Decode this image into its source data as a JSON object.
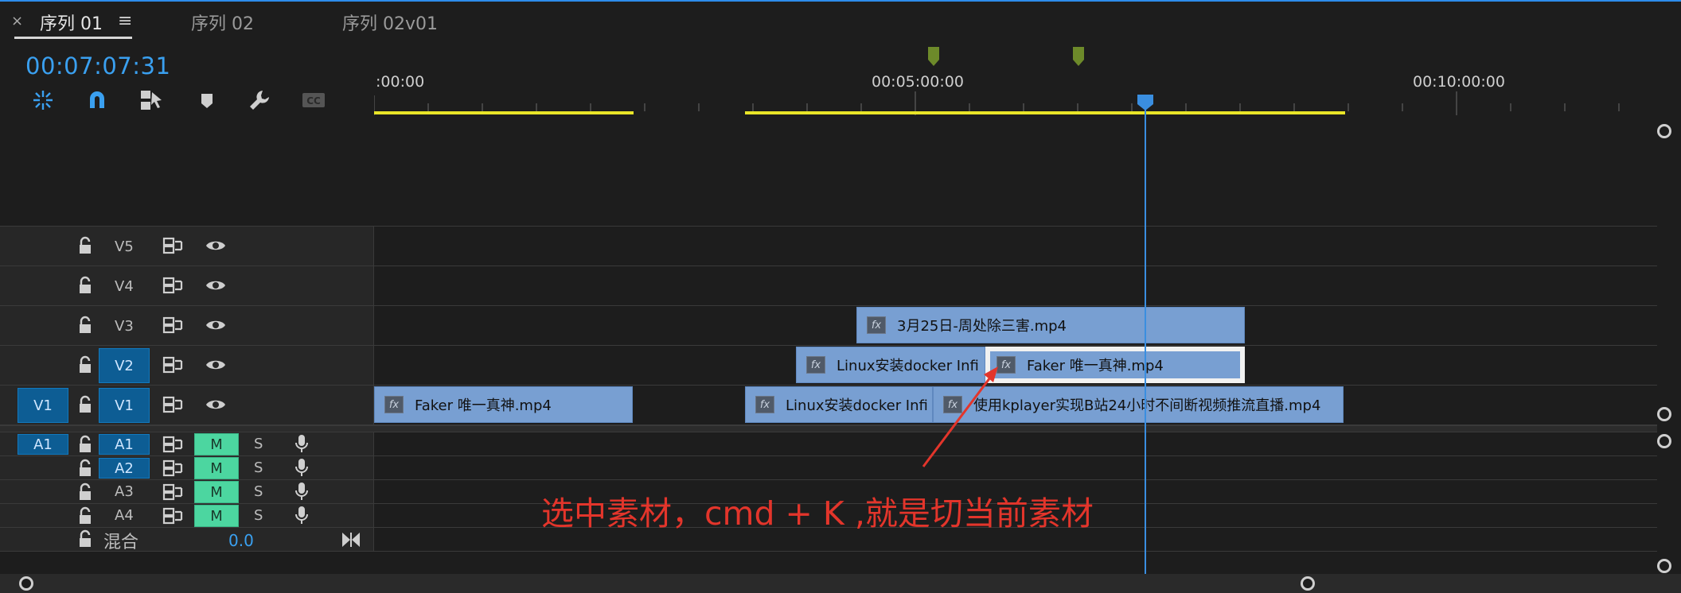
{
  "tabs": {
    "close": "×",
    "menu": "≡",
    "items": [
      "序列 01",
      "序列 02",
      "序列 02v01"
    ]
  },
  "timecode": "00:07:07:31",
  "toolbar": {
    "tools": [
      "snap-icon",
      "magnet-link-icon",
      "linked-selection-icon",
      "add-marker-icon",
      "wrench-icon",
      "cc-icon"
    ]
  },
  "ruler": {
    "labels": [
      ":00:00",
      "00:05:00:00",
      "00:10:00:00"
    ]
  },
  "tracks": {
    "video": [
      {
        "name": "V5",
        "source": "",
        "targeted": false
      },
      {
        "name": "V4",
        "source": "",
        "targeted": false
      },
      {
        "name": "V3",
        "source": "",
        "targeted": false
      },
      {
        "name": "V2",
        "source": "",
        "targeted": true
      },
      {
        "name": "V1",
        "source": "V1",
        "targeted": true
      }
    ],
    "audio": [
      {
        "name": "A1",
        "source": "A1",
        "mute": "M",
        "solo": "S"
      },
      {
        "name": "A2",
        "source": "",
        "mute": "M",
        "solo": "S"
      },
      {
        "name": "A3",
        "source": "",
        "mute": "M",
        "solo": "S"
      },
      {
        "name": "A4",
        "source": "",
        "mute": "M",
        "solo": "S"
      }
    ],
    "master": {
      "label": "混合",
      "value": "0.0"
    }
  },
  "clips": {
    "v3_a": "3月25日-周处除三害.mp4",
    "v2_a": "Linux安装docker Infi",
    "v2_b": "Faker 唯一真神.mp4",
    "v1_a": "Faker 唯一真神.mp4",
    "v1_b": "Linux安装docker Infi",
    "v1_c": "使用kplayer实现B站24小时不间断视频推流直播.mp4",
    "fx": "fx"
  },
  "annotation": "选中素材，cmd + K ,就是切当前素材",
  "colors": {
    "accent": "#2d8ceb",
    "timecode": "#3aa0f0",
    "clip": "#789fd2",
    "inout": "#e9e528",
    "mute": "#4cd6a0",
    "annotation": "#e3352b",
    "marker": "#6d8a2a"
  }
}
